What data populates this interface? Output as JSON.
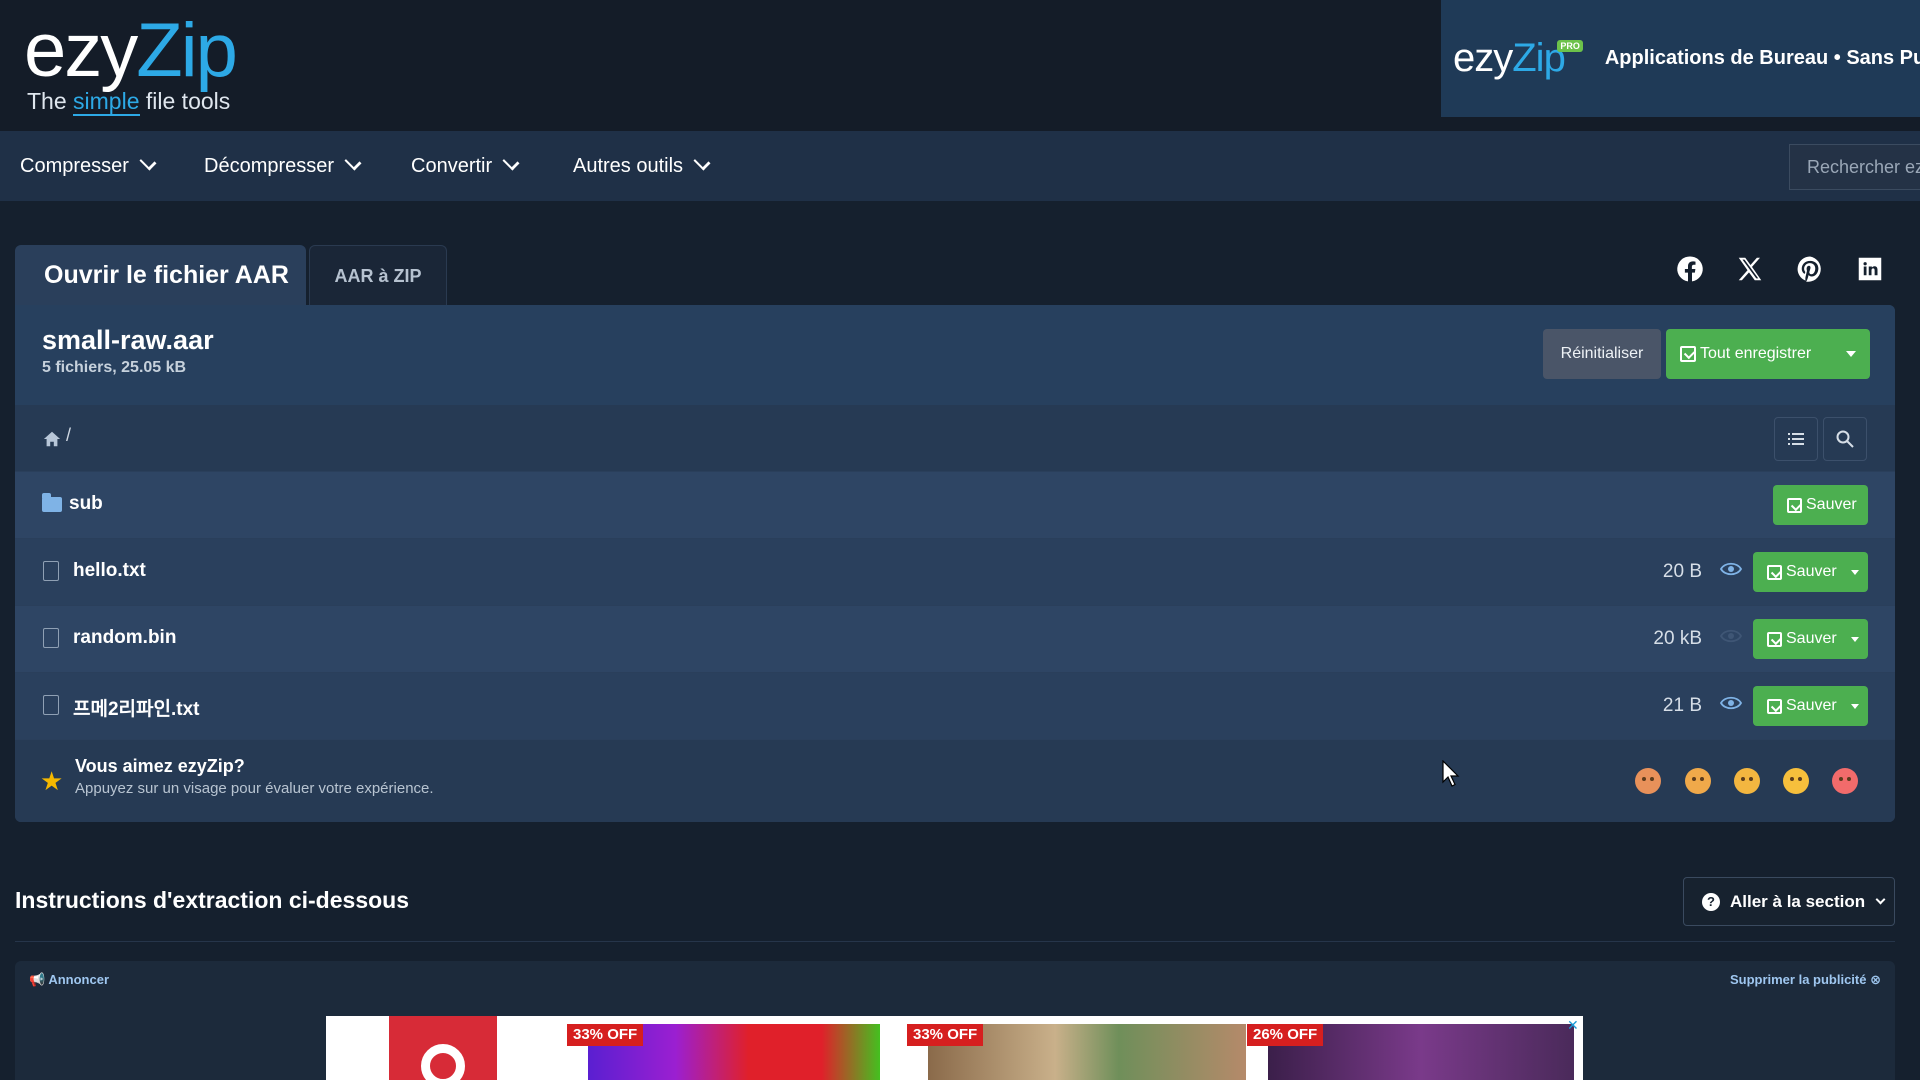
{
  "header": {
    "logo_ezy": "ezy",
    "logo_zip": "Zip",
    "tagline_pre": "The ",
    "tagline_simple": "simple",
    "tagline_post": " file tools",
    "pro_logo_ezy": "ezy",
    "pro_logo_zip": "Zip",
    "pro_badge": "PRO",
    "pro_text": "Applications de Bureau • Sans Pub"
  },
  "nav": {
    "items": [
      {
        "label": "Compresser"
      },
      {
        "label": "Décompresser"
      },
      {
        "label": "Convertir"
      },
      {
        "label": "Autres outils"
      }
    ],
    "search_placeholder": "Rechercher ez"
  },
  "tabs": {
    "active": "Ouvrir le fichier AAR",
    "inactive": "AAR à ZIP"
  },
  "social": [
    "facebook-icon",
    "x-icon",
    "pinterest-icon",
    "linkedin-icon"
  ],
  "archive": {
    "name": "small-raw.aar",
    "summary": "5 fichiers, 25.05 kB",
    "reset_label": "Réinitialiser",
    "save_all_label": "Tout enregistrer",
    "path": "/"
  },
  "files": [
    {
      "type": "folder",
      "name": "sub",
      "size": "",
      "save": "Sauver"
    },
    {
      "type": "file",
      "name": "hello.txt",
      "size": "20 B",
      "save": "Sauver",
      "previewable": true
    },
    {
      "type": "file",
      "name": "random.bin",
      "size": "20 kB",
      "save": "Sauver",
      "previewable": false
    },
    {
      "type": "file",
      "name": "프메2리파인.txt",
      "size": "21 B",
      "save": "Sauver",
      "previewable": true
    }
  ],
  "rating": {
    "title": "Vous aimez ezyZip?",
    "subtitle": "Appuyez sur un visage pour évaluer votre expérience.",
    "faces": [
      "angry-face-icon",
      "sad-face-icon",
      "neutral-face-icon",
      "smile-face-icon",
      "love-face-icon"
    ]
  },
  "instructions": {
    "title": "Instructions d'extraction ci-dessous",
    "goto_label": "Aller à la section"
  },
  "ad": {
    "announce": "Annoncer",
    "remove": "Supprimer la publicité",
    "badges": [
      "33% OFF",
      "33% OFF",
      "26% OFF"
    ]
  },
  "colors": {
    "accent_blue": "#2da9e6",
    "save_green": "#4caf50",
    "star_gold": "#f5b800"
  }
}
